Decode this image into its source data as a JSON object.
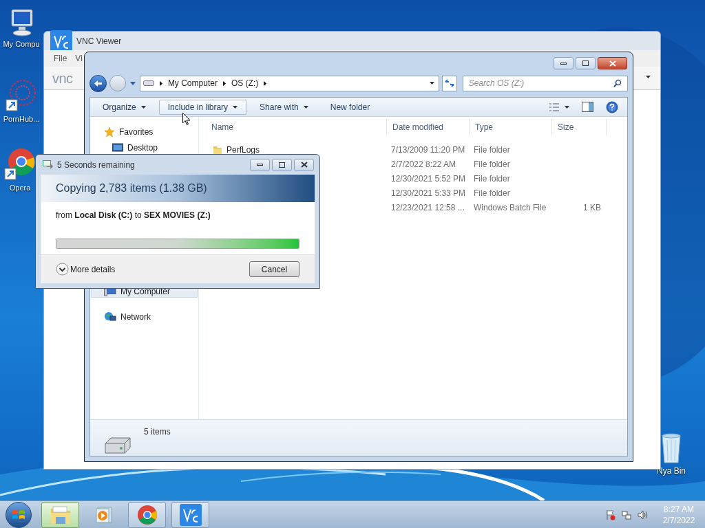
{
  "desktop_icons": [
    {
      "label": "My Compu",
      "kind": "computer"
    },
    {
      "label": "PornHub...",
      "kind": "shortcut"
    },
    {
      "label": "Opera",
      "kind": "browser"
    }
  ],
  "recycle_bin": {
    "label": "Nya Bin"
  },
  "vnc_window": {
    "title": "VNC Viewer",
    "menu": [
      "File",
      "Vi"
    ],
    "logo": "vnc"
  },
  "explorer": {
    "breadcrumb": [
      "My Computer",
      "OS (Z:)"
    ],
    "search": {
      "placeholder": "Search OS (Z:)"
    },
    "toolbar": [
      {
        "label": "Organize",
        "dropdown": true,
        "highlighted": false
      },
      {
        "label": "Include in library",
        "dropdown": true,
        "highlighted": true
      },
      {
        "label": "Share with",
        "dropdown": true,
        "highlighted": false
      },
      {
        "label": "New folder",
        "dropdown": false,
        "highlighted": false
      }
    ],
    "sidebar": [
      {
        "label": "Favorites",
        "kind": "favorites",
        "selected": false
      },
      {
        "label": "Desktop",
        "kind": "desktop",
        "selected": false
      },
      {
        "label": "My Computer",
        "kind": "computer",
        "selected": true
      },
      {
        "label": "Network",
        "kind": "network",
        "selected": false
      }
    ],
    "columns": [
      "Name",
      "Date modified",
      "Type",
      "Size"
    ],
    "rows": [
      {
        "name": "PerfLogs",
        "date": "7/13/2009 11:20 PM",
        "type": "File folder"
      },
      {
        "date": "2/7/2022 8:22 AM",
        "type": "File folder"
      },
      {
        "date": "12/30/2021 5:52 PM",
        "type": "File folder"
      },
      {
        "date": "12/30/2021 5:33 PM",
        "type": "File folder"
      },
      {
        "date": "12/23/2021 12:58 ...",
        "type": "Windows Batch File",
        "size": "1 KB"
      }
    ],
    "status": "5 items"
  },
  "copy_dialog": {
    "title": "5 Seconds remaining",
    "heading": "Copying 2,783 items (1.38 GB)",
    "detail": "from **Local Disk (C:)** to **SEX MOVIES (Z:)**",
    "progress": {
      "level": 1
    },
    "more_details": "More details",
    "cancel": "Cancel"
  },
  "taskbar": {
    "items": [
      {
        "kind": "explorer",
        "active": true
      },
      {
        "kind": "media",
        "active": false,
        "running": false
      },
      {
        "kind": "chrome",
        "active": false,
        "running": true
      },
      {
        "kind": "vnc",
        "active": false,
        "running": true
      }
    ],
    "time": "8:27 AM",
    "date": "2/7/2022"
  }
}
